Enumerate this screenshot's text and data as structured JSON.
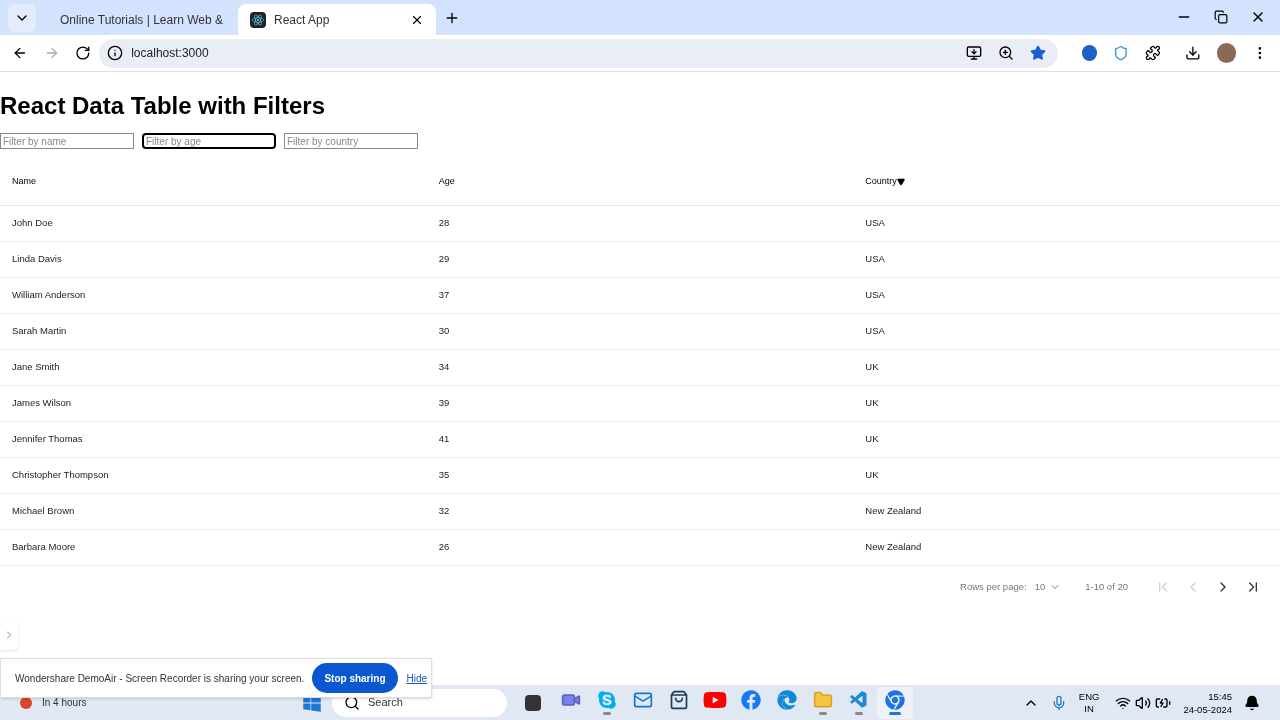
{
  "browser": {
    "tabs": [
      {
        "title": "Online Tutorials | Learn Web &",
        "selected": false,
        "kind": "picture"
      },
      {
        "title": "React App",
        "selected": true,
        "kind": "react"
      }
    ],
    "address": "localhost:3000"
  },
  "page": {
    "title": "React Data Table with Filters",
    "filters": [
      {
        "placeholder": "Filter by name",
        "focused": false
      },
      {
        "placeholder": "Filter by age",
        "focused": true
      },
      {
        "placeholder": "Filter by country",
        "focused": false
      }
    ],
    "table": {
      "columns": [
        {
          "label": "Name",
          "sorted": false
        },
        {
          "label": "Age",
          "sorted": false
        },
        {
          "label": "Country",
          "sorted": true
        }
      ],
      "rows": [
        [
          "John Doe",
          "28",
          "USA"
        ],
        [
          "Linda Davis",
          "29",
          "USA"
        ],
        [
          "William Anderson",
          "37",
          "USA"
        ],
        [
          "Sarah Martin",
          "30",
          "USA"
        ],
        [
          "Jane Smith",
          "34",
          "UK"
        ],
        [
          "James Wilson",
          "39",
          "UK"
        ],
        [
          "Jennifer Thomas",
          "41",
          "UK"
        ],
        [
          "Christopher Thompson",
          "35",
          "UK"
        ],
        [
          "Michael Brown",
          "32",
          "New Zealand"
        ],
        [
          "Barbara Moore",
          "26",
          "New Zealand"
        ]
      ]
    },
    "pagination": {
      "rows_label": "Rows per page:",
      "rows_per_page": "10",
      "range": "1-10 of 20",
      "buttons": [
        {
          "kind": "first",
          "disabled": true
        },
        {
          "kind": "prev",
          "disabled": true
        },
        {
          "kind": "next",
          "disabled": false
        },
        {
          "kind": "last",
          "disabled": false
        }
      ]
    }
  },
  "notification": {
    "message": "Wondershare DemoAir - Screen Recorder is sharing your screen.",
    "button": "Stop sharing",
    "link": "Hide"
  },
  "taskbar": {
    "weather": "In 4 hours",
    "search": "Search",
    "apps": [
      {
        "kind": "teams",
        "running": false,
        "selected": false
      },
      {
        "kind": "skype",
        "running": true,
        "selected": false
      },
      {
        "kind": "mail",
        "running": false,
        "selected": false
      },
      {
        "kind": "store",
        "running": false,
        "selected": false
      },
      {
        "kind": "youtube",
        "running": false,
        "selected": false
      },
      {
        "kind": "facebook",
        "running": false,
        "selected": false
      },
      {
        "kind": "edge",
        "running": false,
        "selected": false
      },
      {
        "kind": "files",
        "running": true,
        "selected": false
      },
      {
        "kind": "vscode",
        "running": true,
        "selected": false
      },
      {
        "kind": "chrome",
        "running": true,
        "selected": true
      }
    ],
    "language": [
      "ENG",
      "IN"
    ],
    "time": "15:45",
    "date": "24-05-2024"
  }
}
